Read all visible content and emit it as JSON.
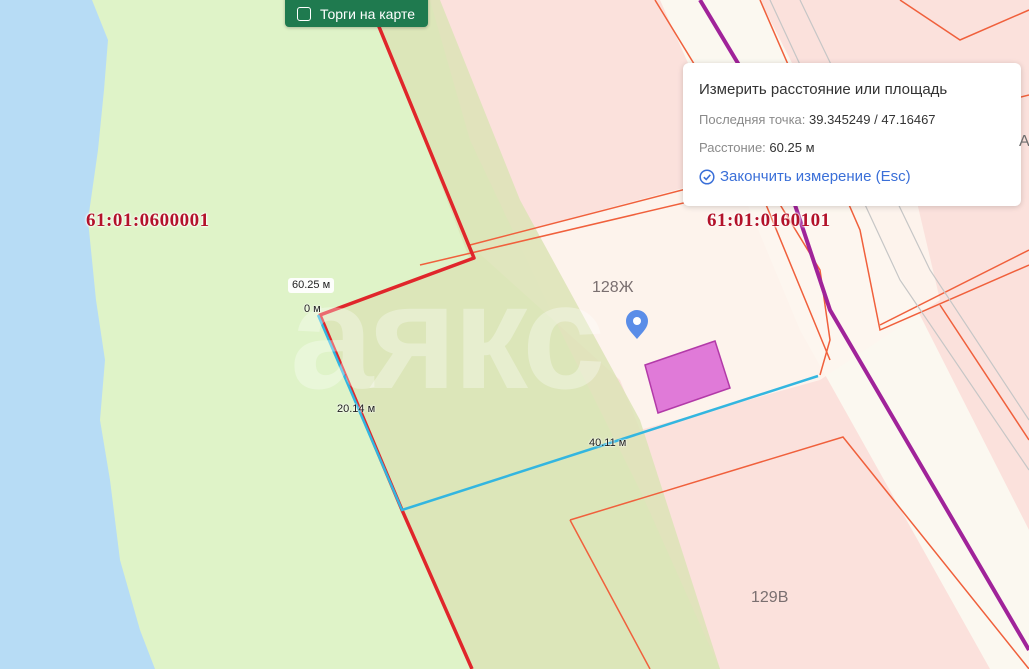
{
  "toolbar": {
    "auction_toggle_label": "Торги на карте"
  },
  "measure_panel": {
    "title": "Измерить расстояние или площадь",
    "last_point_label": "Последняя точка:",
    "last_point_value": "39.345249 / 47.16467",
    "distance_label": "Расстоние:",
    "distance_value": "60.25 м",
    "finish_label": "Закончить измерение (Esc)"
  },
  "map": {
    "cadastral_quarters": [
      "61:01:0600001",
      "61:01:0160101"
    ],
    "plot_numbers": [
      "128Ж",
      "129В"
    ],
    "partial_label": "А",
    "watermark": "аякс",
    "measurements": {
      "total": "60.25 м",
      "start": "0 м",
      "segment_1": "20.14 м",
      "segment_2": "40.11 м"
    },
    "colors": {
      "water": "#b7dcf5",
      "green_zone": "#dff3c8",
      "cadastral_fill": "#fbe1dc",
      "quarter_border": "#e0262b",
      "plot_border": "#f0603c",
      "measure_line": "#33b6e0",
      "road_line": "#a0239a",
      "object_fill": "#e07ad8",
      "pin": "#5a8de8"
    }
  }
}
